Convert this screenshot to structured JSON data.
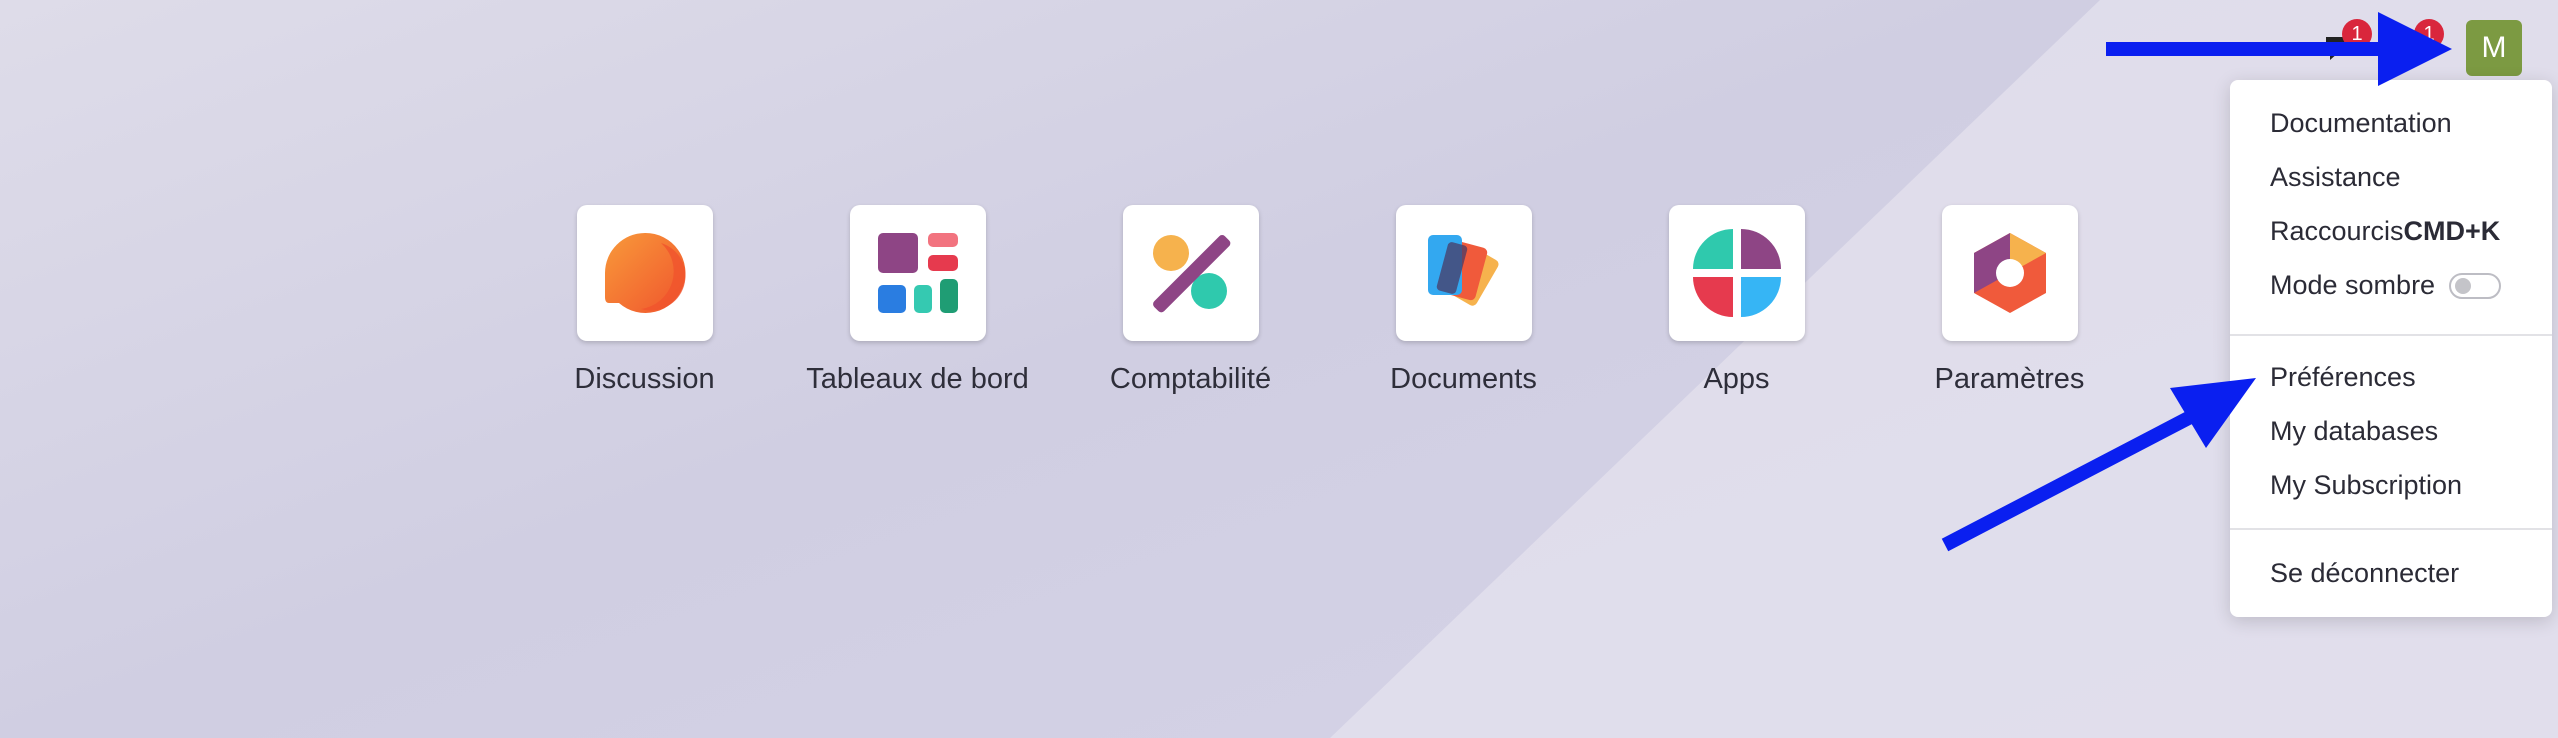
{
  "systray": {
    "messages_badge": "1",
    "activity_badge": "1",
    "avatar_initial": "M",
    "avatar_color": "#7c9a42",
    "badge_color": "#d9263c"
  },
  "apps": [
    {
      "label": "Discussion",
      "icon": "discussion-icon"
    },
    {
      "label": "Tableaux de bord",
      "icon": "dashboards-icon"
    },
    {
      "label": "Comptabilité",
      "icon": "accounting-icon"
    },
    {
      "label": "Documents",
      "icon": "documents-icon"
    },
    {
      "label": "Apps",
      "icon": "apps-icon"
    },
    {
      "label": "Paramètres",
      "icon": "settings-icon"
    }
  ],
  "user_menu": {
    "documentation": "Documentation",
    "support": "Assistance",
    "shortcuts": "Raccourcis",
    "shortcuts_key": "CMD+K",
    "dark_mode": "Mode sombre",
    "dark_mode_on": false,
    "preferences": "Préférences",
    "my_databases": "My databases",
    "my_subscription": "My Subscription",
    "logout": "Se déconnecter"
  },
  "annotation_color": "#0a1ff0"
}
